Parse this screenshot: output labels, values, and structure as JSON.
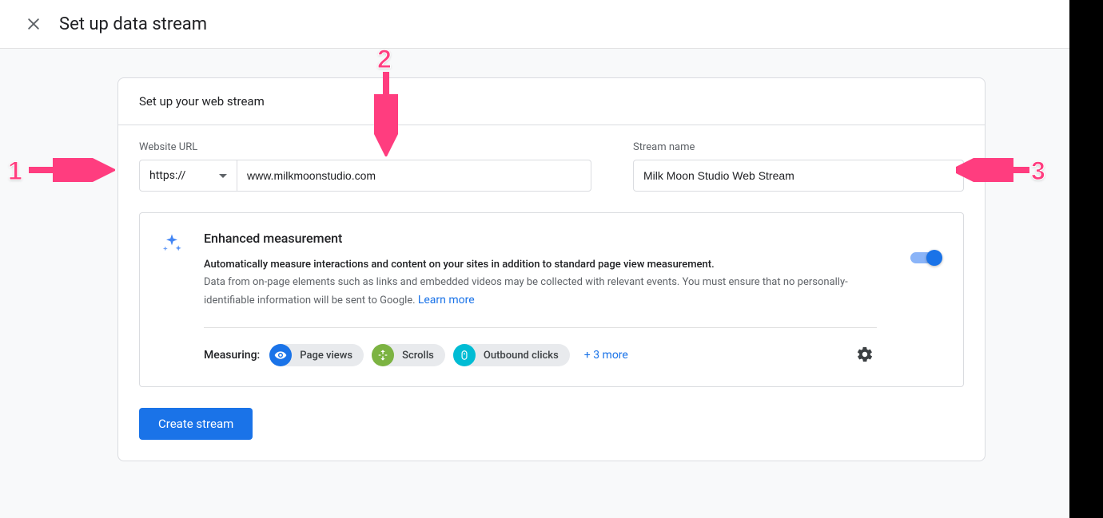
{
  "header": {
    "title": "Set up data stream"
  },
  "card": {
    "subtitle": "Set up your web stream"
  },
  "form": {
    "url_label": "Website URL",
    "protocol": "https://",
    "url_value": "www.milkmoonstudio.com",
    "stream_label": "Stream name",
    "stream_value": "Milk Moon Studio Web Stream"
  },
  "enhanced": {
    "title": "Enhanced measurement",
    "desc": "Automatically measure interactions and content on your sites in addition to standard page view measurement.",
    "note": "Data from on-page elements such as links and embedded videos may be collected with relevant events. You must ensure that no personally-identifiable information will be sent to Google. ",
    "learn_more": "Learn more",
    "measuring_label": "Measuring:",
    "chips": [
      {
        "label": "Page views"
      },
      {
        "label": "Scrolls"
      },
      {
        "label": "Outbound clicks"
      }
    ],
    "more": "+ 3 more"
  },
  "action": {
    "create": "Create stream"
  },
  "annotations": {
    "1": "1",
    "2": "2",
    "3": "3"
  }
}
